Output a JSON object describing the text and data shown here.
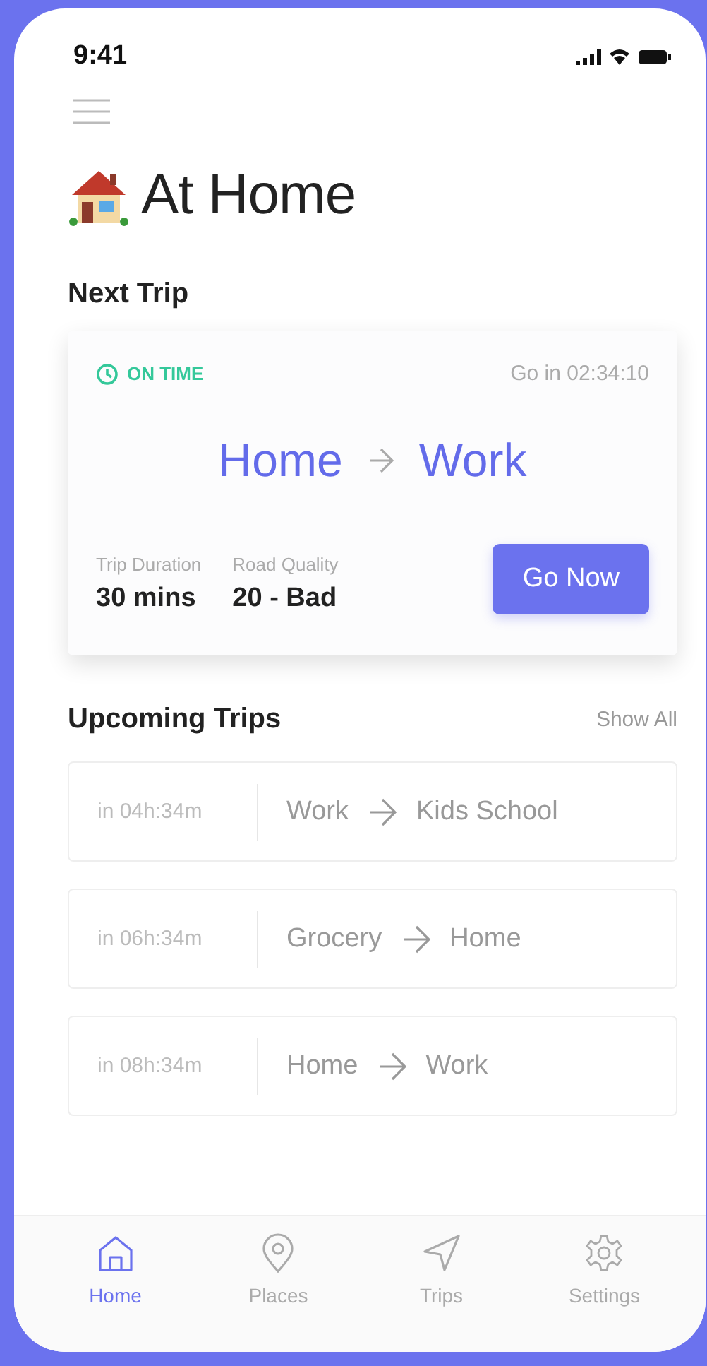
{
  "status_bar": {
    "time": "9:41"
  },
  "title": "At Home",
  "next_trip": {
    "heading": "Next Trip",
    "status": "ON TIME",
    "countdown": "Go in 02:34:10",
    "from": "Home",
    "to": "Work",
    "stats": [
      {
        "label": "Trip Duration",
        "value": "30 mins"
      },
      {
        "label": "Road Quality",
        "value": "20 - Bad"
      }
    ],
    "button": "Go Now"
  },
  "upcoming": {
    "heading": "Upcoming Trips",
    "action": "Show All",
    "trips": [
      {
        "time": "in 04h:34m",
        "from": "Work",
        "to": "Kids School"
      },
      {
        "time": "in 06h:34m",
        "from": "Grocery",
        "to": "Home"
      },
      {
        "time": "in 08h:34m",
        "from": "Home",
        "to": "Work"
      }
    ]
  },
  "tab_bar": [
    {
      "label": "Home",
      "selected": true
    },
    {
      "label": "Places",
      "selected": false
    },
    {
      "label": "Trips",
      "selected": false
    },
    {
      "label": "Settings",
      "selected": false
    }
  ]
}
